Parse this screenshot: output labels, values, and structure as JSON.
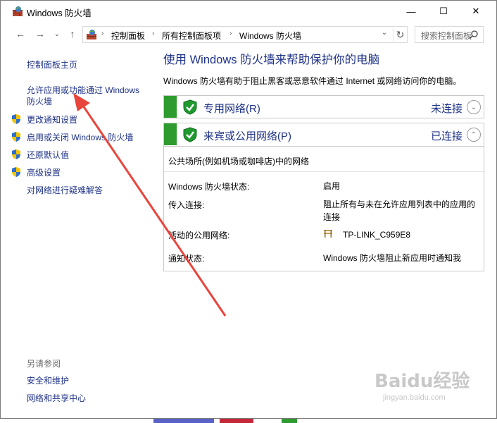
{
  "window": {
    "title": "Windows 防火墙"
  },
  "titlebar": {
    "minimize": "—",
    "maximize": "☐",
    "close": "✕"
  },
  "nav": {
    "back": "←",
    "forward": "→",
    "dropdown": "⌄",
    "up": "↑"
  },
  "address": {
    "crumbs": [
      "控制面板",
      "所有控制面板项",
      "Windows 防火墙"
    ],
    "sep": "›",
    "dropdown": "⌄",
    "refresh": "↻"
  },
  "search": {
    "placeholder": "搜索控制面板"
  },
  "sidebar": {
    "home": "控制面板主页",
    "allow_app_line1": "允许应用或功能通过 Windows",
    "allow_app_line2": "防火墙",
    "items": [
      "更改通知设置",
      "启用或关闭 Windows 防火墙",
      "还原默认值",
      "高级设置"
    ],
    "troubleshoot": "对网络进行疑难解答",
    "see_also": "另请参阅",
    "see_also_links": [
      "安全和维护",
      "网络和共享中心"
    ]
  },
  "main": {
    "title": "使用 Windows 防火墙来帮助保护你的电脑",
    "description": "Windows 防火墙有助于阻止黑客或恶意软件通过 Internet 或网络访问你的电脑。",
    "private": {
      "name": "专用网络(R)",
      "status": "未连接",
      "chevron": "⌄"
    },
    "public": {
      "name": "来宾或公用网络(P)",
      "status": "已连接",
      "chevron": "⌃",
      "subtitle": "公共场所(例如机场或咖啡店)中的网络",
      "rows": [
        {
          "label": "Windows 防火墙状态:",
          "value": "启用"
        },
        {
          "label": "传入连接:",
          "value": "阻止所有与未在允许应用列表中的应用的连接"
        },
        {
          "label": "活动的公用网络:",
          "value": "TP-LINK_C959E8"
        },
        {
          "label": "通知状态:",
          "value": "Windows 防火墙阻止新应用时通知我"
        }
      ]
    }
  },
  "watermark": {
    "text": "Baidu经验",
    "sub": "jingyan.baidu.com"
  },
  "colors": {
    "link": "#1e3287",
    "green": "#2e9b2e",
    "arrow": "#e8453c"
  },
  "icons": [
    "firewall-icon",
    "shield-icon",
    "search-icon",
    "network-icon"
  ]
}
